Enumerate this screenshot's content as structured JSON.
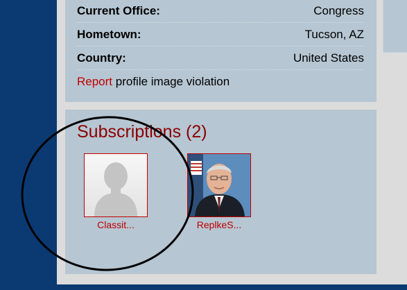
{
  "profile": {
    "rows": [
      {
        "label": "Current Office:",
        "value": "Congress"
      },
      {
        "label": "Hometown:",
        "value": "Tucson, AZ"
      },
      {
        "label": "Country:",
        "value": "United States"
      }
    ],
    "report_link": "Report",
    "report_rest": " profile image violation"
  },
  "subscriptions": {
    "title": "Subscriptions (2)",
    "items": [
      {
        "name": "Classit...",
        "avatar": "default-avatar-icon"
      },
      {
        "name": "ReplkeS...",
        "avatar": "profile-photo"
      }
    ]
  },
  "colors": {
    "accent": "#c00000",
    "title": "#8b0000",
    "panel": "#b6c6d2",
    "sidebar": "#0b3a73"
  }
}
